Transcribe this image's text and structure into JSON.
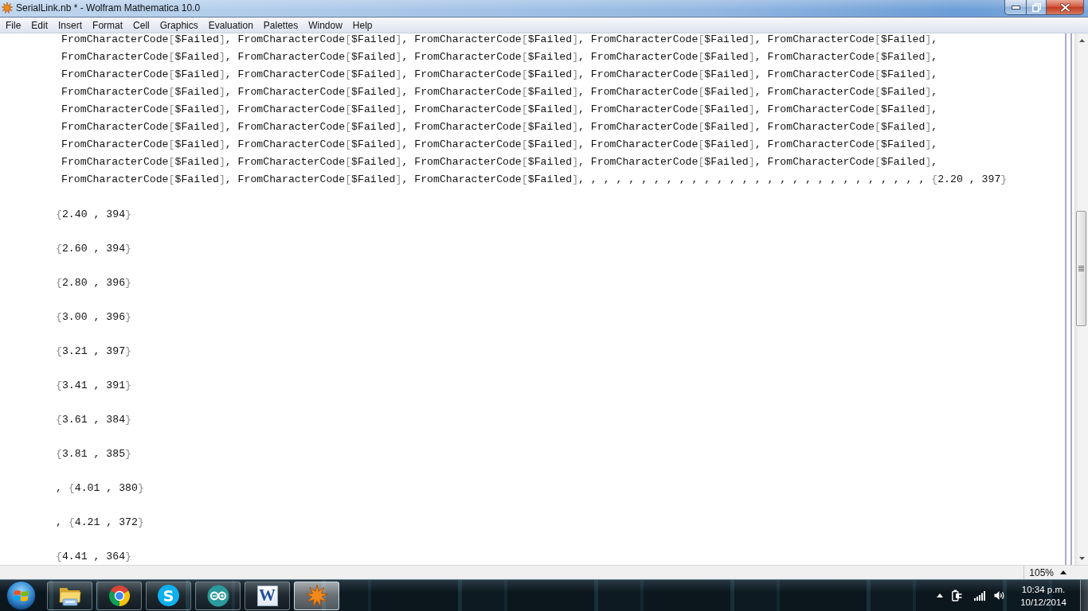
{
  "window": {
    "title": "SerialLink.nb * - Wolfram Mathematica 10.0"
  },
  "menu_bar": [
    "File",
    "Edit",
    "Insert",
    "Format",
    "Cell",
    "Graphics",
    "Evaluation",
    "Palettes",
    "Window",
    "Help"
  ],
  "notebook": {
    "output_lines": [
      "FromCharacterCode[$Failed], FromCharacterCode[$Failed], FromCharacterCode[$Failed], FromCharacterCode[$Failed], FromCharacterCode[$Failed],",
      "FromCharacterCode[$Failed], FromCharacterCode[$Failed], FromCharacterCode[$Failed], FromCharacterCode[$Failed], FromCharacterCode[$Failed],",
      "FromCharacterCode[$Failed], FromCharacterCode[$Failed], FromCharacterCode[$Failed], FromCharacterCode[$Failed], FromCharacterCode[$Failed],",
      "FromCharacterCode[$Failed], FromCharacterCode[$Failed], FromCharacterCode[$Failed], FromCharacterCode[$Failed], FromCharacterCode[$Failed],",
      "FromCharacterCode[$Failed], FromCharacterCode[$Failed], FromCharacterCode[$Failed], FromCharacterCode[$Failed], FromCharacterCode[$Failed],",
      "FromCharacterCode[$Failed], FromCharacterCode[$Failed], FromCharacterCode[$Failed], FromCharacterCode[$Failed], FromCharacterCode[$Failed],",
      "FromCharacterCode[$Failed], FromCharacterCode[$Failed], FromCharacterCode[$Failed], FromCharacterCode[$Failed], FromCharacterCode[$Failed],",
      "FromCharacterCode[$Failed], FromCharacterCode[$Failed], FromCharacterCode[$Failed], FromCharacterCode[$Failed], FromCharacterCode[$Failed],",
      "FromCharacterCode[$Failed], FromCharacterCode[$Failed], FromCharacterCode[$Failed], , , , , , , , , , , , , , , , , , , , , , , , , , , , {2.20 , 397}"
    ],
    "cells": [
      "{2.40 , 394}",
      "{2.60 , 394}",
      "{2.80 , 396}",
      "{3.00 , 396}",
      "{3.21 , 397}",
      "{3.41 , 391}",
      "{3.61 , 384}",
      "{3.81 , 385}",
      ", {4.01 , 380}",
      ", {4.21 , 372}",
      "{4.41 , 364}"
    ]
  },
  "status_bar": {
    "magnification": "105%"
  },
  "taskbar": {
    "apps": [
      {
        "kind": "folder",
        "selected": false
      },
      {
        "kind": "wheel",
        "selected": false
      },
      {
        "kind": "bubble",
        "glyph": "S",
        "selected": false
      },
      {
        "kind": "loop",
        "selected": false
      },
      {
        "kind": "page",
        "glyph": "W",
        "selected": false
      },
      {
        "kind": "star",
        "selected": true
      }
    ],
    "clock": {
      "time": "10:34 p.m.",
      "date": "10/12/2014"
    }
  }
}
